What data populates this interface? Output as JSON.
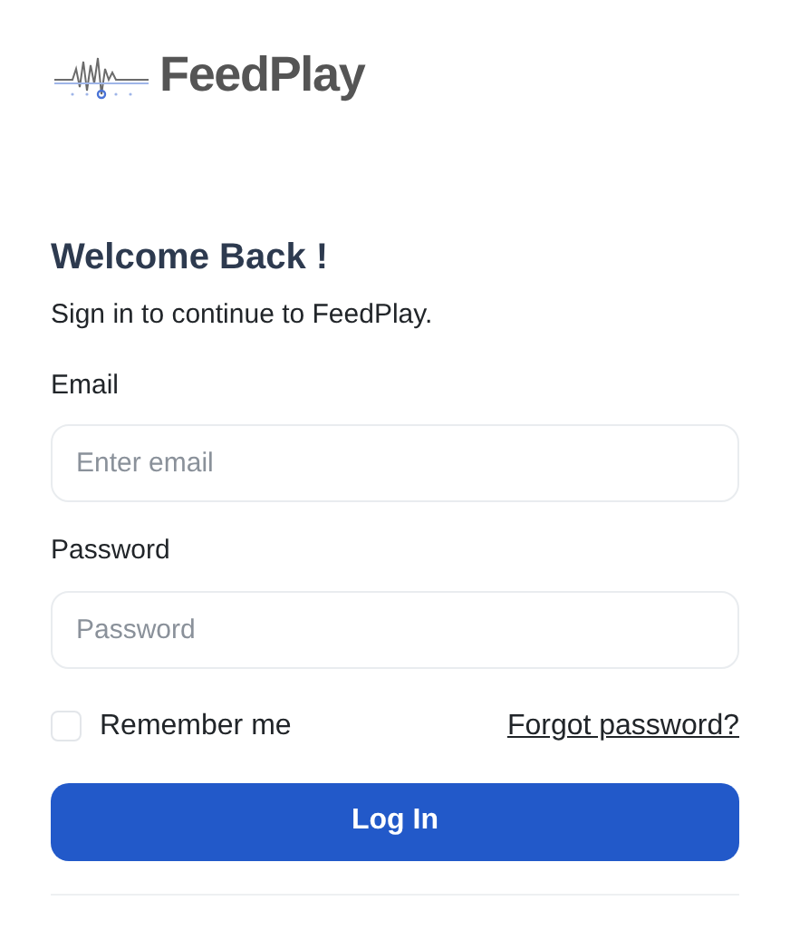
{
  "logo": {
    "text": "FeedPlay"
  },
  "heading": "Welcome Back !",
  "subtitle": "Sign in to continue to FeedPlay.",
  "fields": [
    {
      "label": "Email",
      "placeholder": "Enter email"
    },
    {
      "label": "Password",
      "placeholder": "Password"
    }
  ],
  "remember": {
    "label": "Remember me",
    "checked": false
  },
  "forgot_link": "Forgot password?",
  "login_button": "Log In"
}
